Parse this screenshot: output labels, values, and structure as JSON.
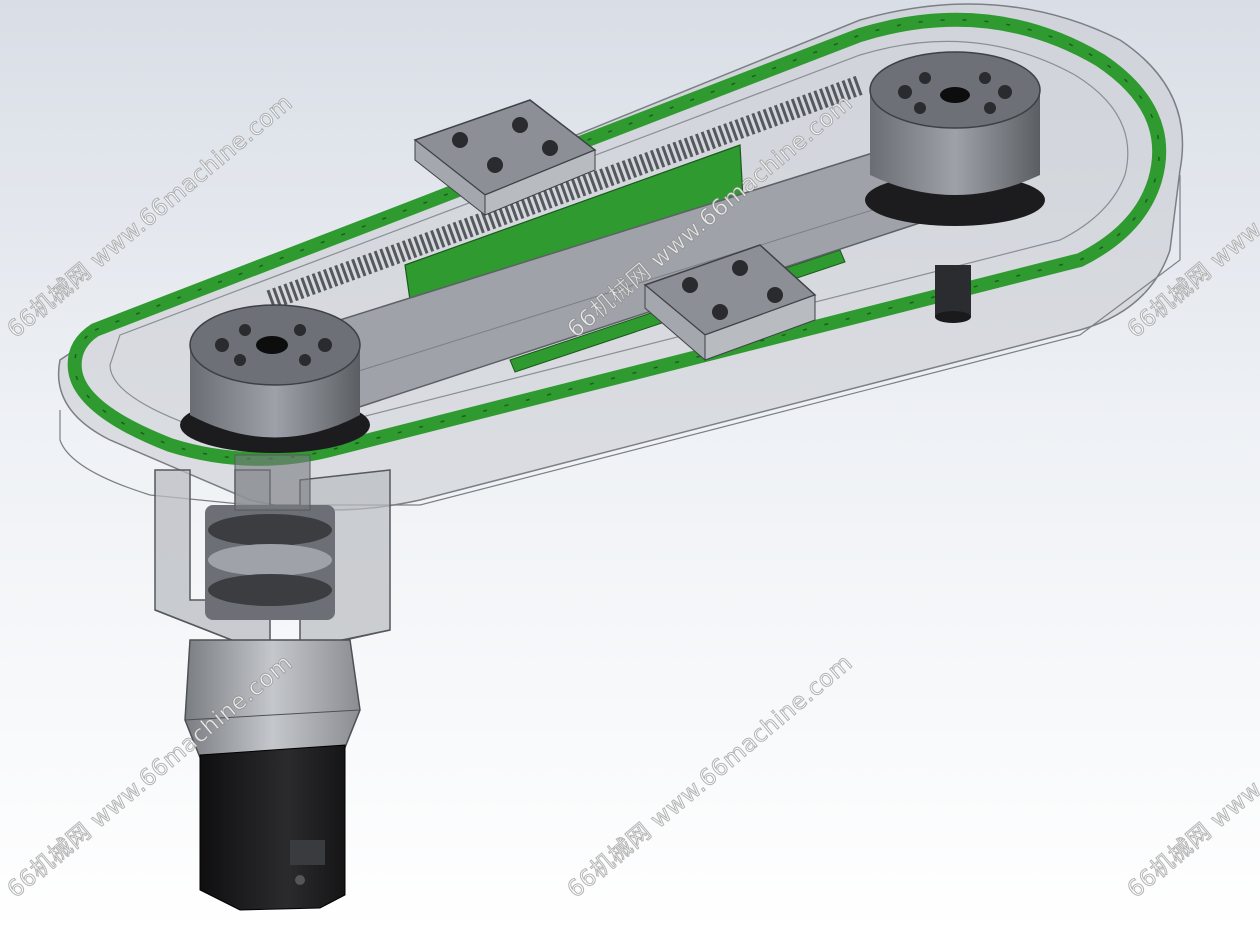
{
  "watermark": {
    "text": "66机械网 www.66machine.com",
    "instances": [
      "w1",
      "w2",
      "w3",
      "w4",
      "w5",
      "w6",
      "w7"
    ]
  },
  "colors": {
    "track_green": "#2f9a2f",
    "gray_body": "#a8acb3",
    "dark_gray": "#4a4d52",
    "motor_black": "#1c1c1e",
    "background_top": "#d9dee6",
    "background_bottom": "#ffffff"
  },
  "scene": {
    "subject": "cad-model-belt-conveyor-with-motor",
    "components": [
      "oval-green-track",
      "belt",
      "left-pulley",
      "right-pulley",
      "carriage-plate-back",
      "carriage-plate-front",
      "gear-rack",
      "green-linear-guide",
      "support-frame",
      "coupling",
      "gearbox",
      "servo-motor",
      "idler-post"
    ]
  }
}
